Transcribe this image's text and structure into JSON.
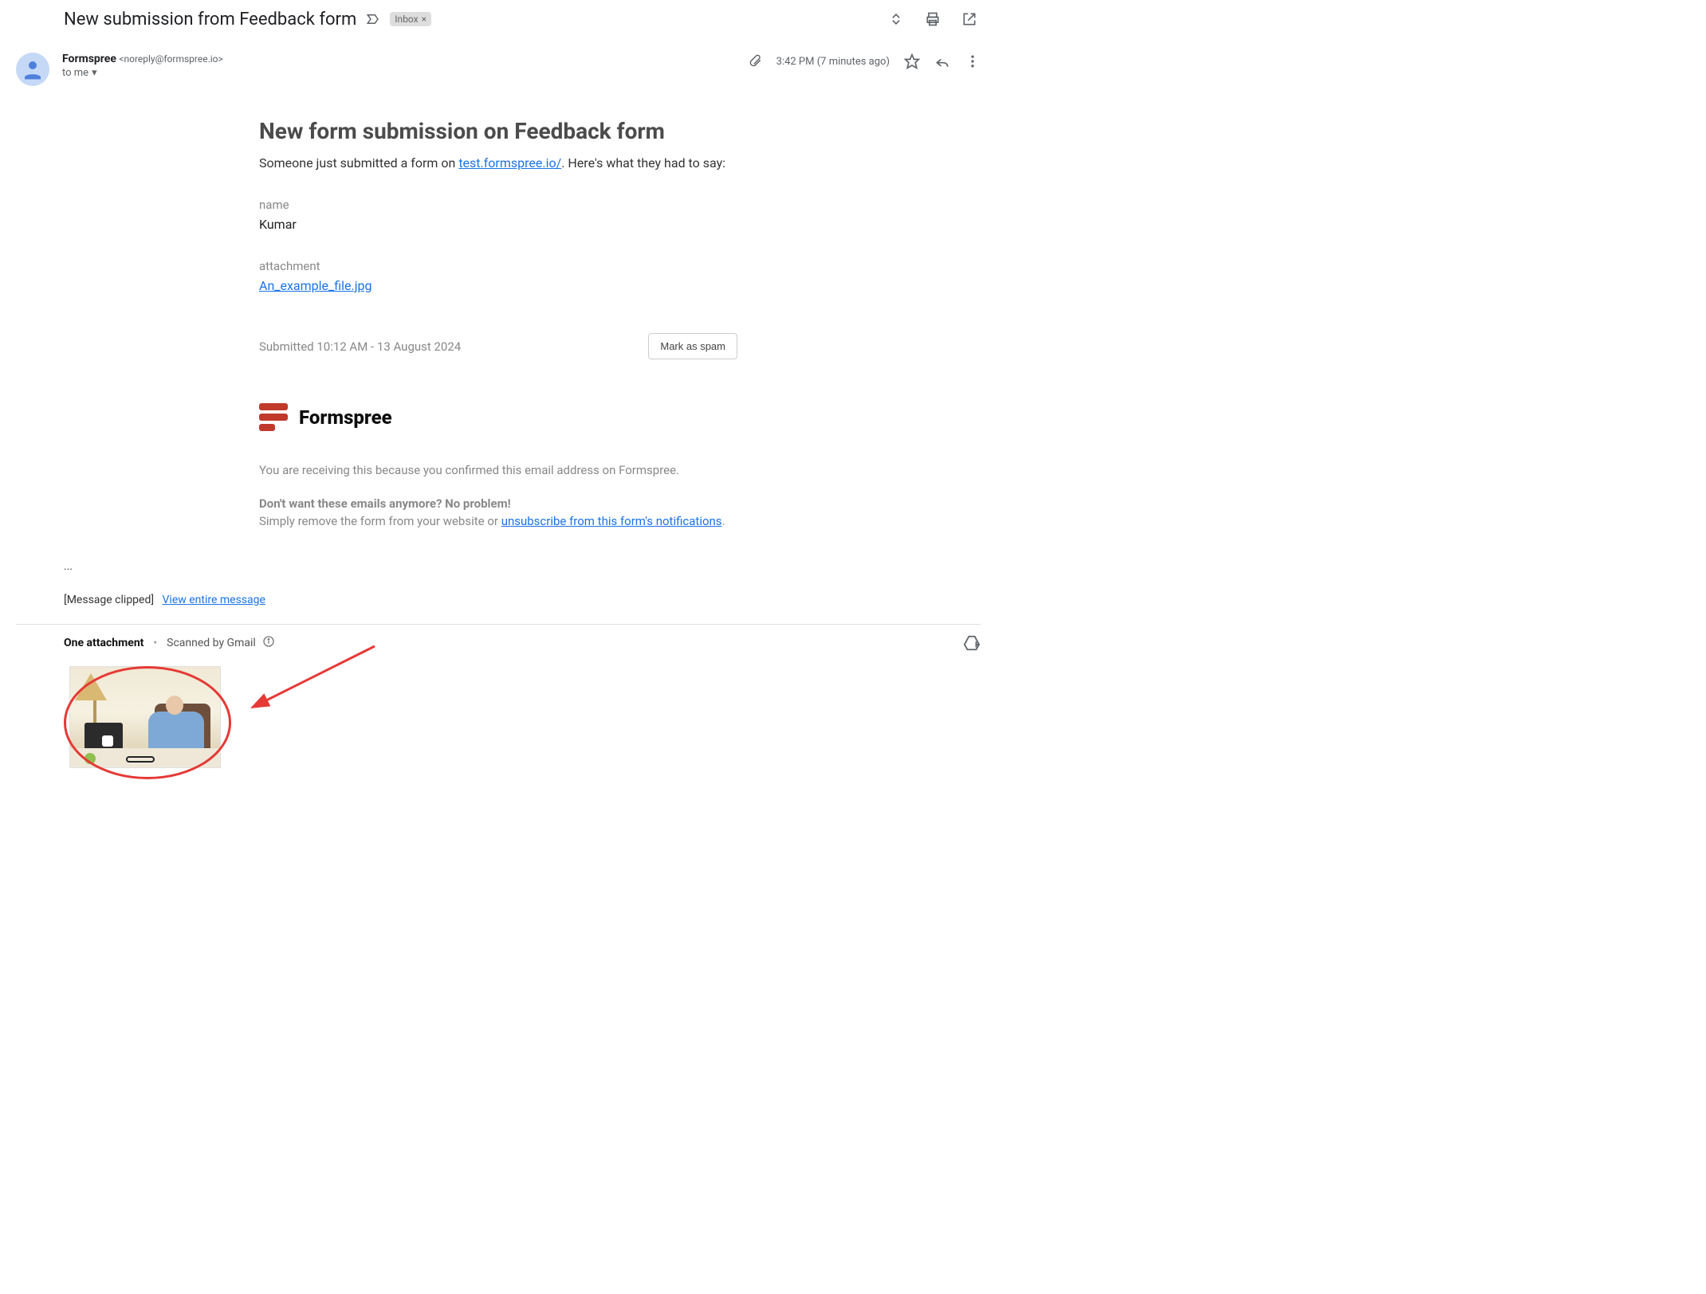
{
  "header": {
    "subject": "New submission from Feedback form",
    "inbox_chip": "Inbox"
  },
  "sender": {
    "name": "Formspree",
    "email": "<noreply@formspree.io>",
    "to_line": "to me"
  },
  "meta": {
    "time": "3:42 PM (7 minutes ago)"
  },
  "body": {
    "title": "New form submission on Feedback form",
    "lede_prefix": "Someone just submitted a form on ",
    "lede_link": "test.formspree.io/",
    "lede_suffix": ". Here's what they had to say:",
    "name_label": "name",
    "name_value": "Kumar",
    "attachment_label": "attachment",
    "attachment_link": "An_example_file.jpg",
    "submitted": "Submitted 10:12 AM - 13 August 2024",
    "spam_btn": "Mark as spam",
    "brand": "Formspree",
    "receiving": "You are receiving this because you confirmed this email address on Formspree.",
    "no_more": "Don't want these emails anymore? No problem!",
    "unsub_prefix": "Simply remove the form from your website or ",
    "unsub_link": "unsubscribe from this form's notifications",
    "unsub_suffix": "."
  },
  "tail": {
    "ellipsis": "...",
    "clipped": "[Message clipped]",
    "view_entire": "View entire message"
  },
  "attachments": {
    "one": "One attachment",
    "scanned": "Scanned by Gmail"
  }
}
